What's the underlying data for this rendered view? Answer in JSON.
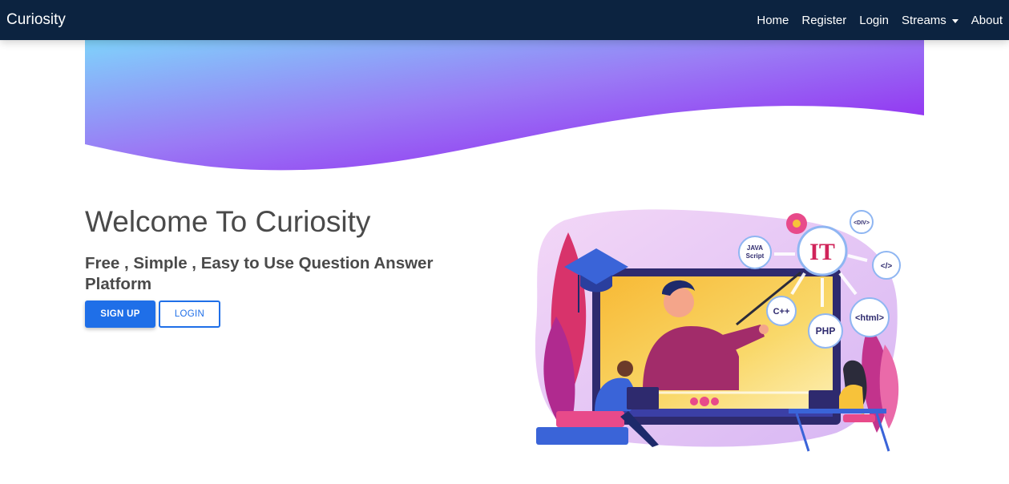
{
  "navbar": {
    "brand": "Curiosity",
    "links": {
      "home": "Home",
      "register": "Register",
      "login": "Login",
      "streams": "Streams",
      "about": "About"
    }
  },
  "hero": {
    "title": "Welcome To Curiosity",
    "subtitle": "Free , Simple , Easy to Use Question Answer Platform",
    "signup_label": "SIGN UP",
    "login_label": "LOGIN"
  },
  "illustration": {
    "it_label": "IT",
    "bubbles": {
      "java_line1": "JAVA",
      "java_line2": "Script",
      "div": "<DIV>",
      "code": "</>",
      "cpp": "C++",
      "php": "PHP",
      "html": "<html>"
    }
  },
  "colors": {
    "navbar_bg": "#0c2340",
    "primary": "#1f6fe8",
    "wave_start": "#7fd3fb",
    "wave_mid": "#9a7bf5",
    "wave_end": "#8f10ef",
    "text": "#4a4a4a"
  }
}
